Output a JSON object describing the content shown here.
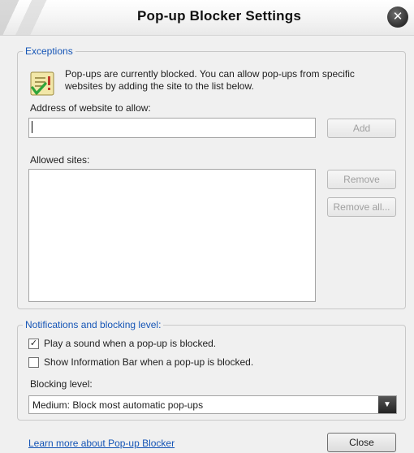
{
  "window": {
    "title": "Pop-up Blocker Settings",
    "close_glyph": "✕"
  },
  "exceptions": {
    "legend": "Exceptions",
    "info_line1": "Pop-ups are currently blocked.  You can allow pop-ups from specific",
    "info_line2": "websites by adding the site to the list below.",
    "address_label": "Address of website to allow:",
    "address_value": "",
    "add_button": "Add",
    "allowed_label": "Allowed sites:",
    "allowed_sites": [],
    "remove_button": "Remove",
    "remove_all_button": "Remove all..."
  },
  "notifications": {
    "legend": "Notifications and blocking level:",
    "play_sound_label": "Play a sound when a pop-up is blocked.",
    "play_sound_checked": true,
    "show_bar_label": "Show Information Bar when a pop-up is blocked.",
    "show_bar_checked": false,
    "blocking_label": "Blocking level:",
    "blocking_value": "Medium: Block most automatic pop-ups"
  },
  "footer": {
    "learn_more_link": "Learn more about Pop-up Blocker",
    "close_button": "Close"
  },
  "colors": {
    "link": "#1555b6",
    "legend": "#1555b6"
  },
  "icons": {
    "info": "checklist-warning-icon",
    "dropdown": "chevron-down-icon"
  }
}
